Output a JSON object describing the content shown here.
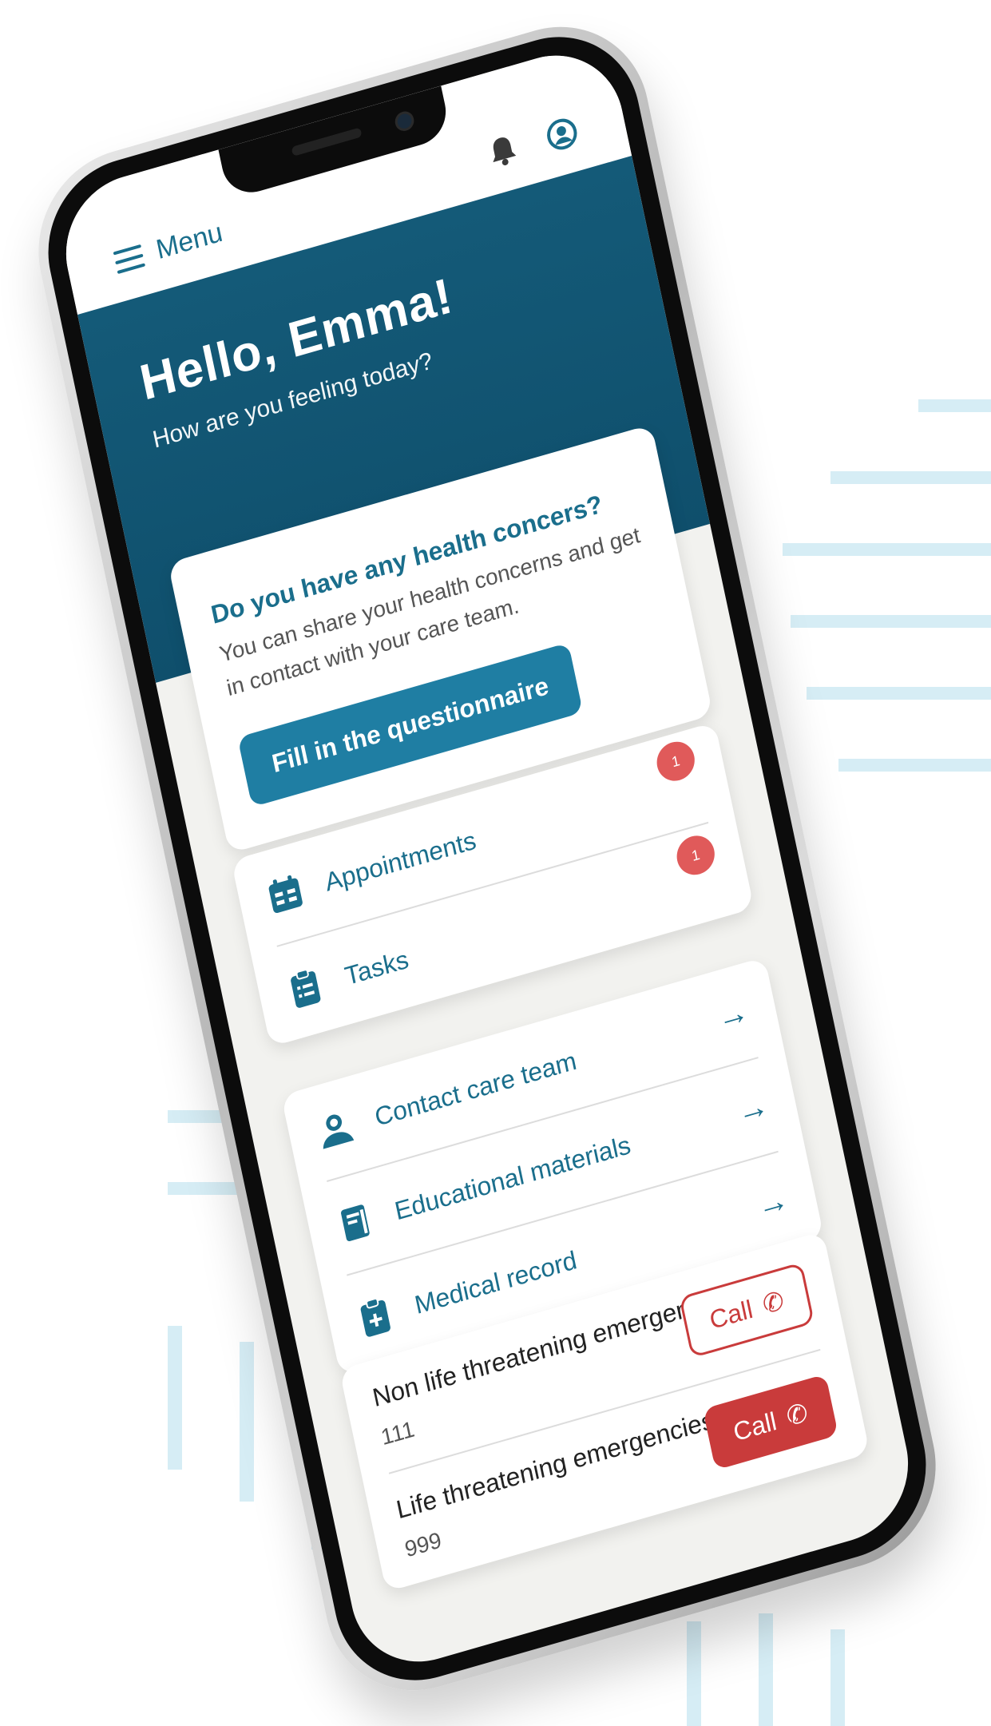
{
  "topbar": {
    "menu_label": "Menu"
  },
  "hero": {
    "greeting": "Hello, Emma!",
    "subtitle": "How are you feeling today?"
  },
  "concern_card": {
    "title": "Do you have any health concers?",
    "body": "You can share your health concerns and get in contact with your care team.",
    "button_label": "Fill in the questionnaire"
  },
  "list1": {
    "items": [
      {
        "label": "Appointments",
        "badge": "1",
        "icon": "calendar-icon"
      },
      {
        "label": "Tasks",
        "badge": "1",
        "icon": "clipboard-icon"
      }
    ]
  },
  "list2": {
    "items": [
      {
        "label": "Contact care team",
        "icon": "care-team-icon"
      },
      {
        "label": "Educational materials",
        "icon": "book-icon"
      },
      {
        "label": "Medical record",
        "icon": "medical-record-icon"
      }
    ]
  },
  "emergency": {
    "items": [
      {
        "title": "Non life threatening emergencies",
        "number": "111",
        "call_label": "Call"
      },
      {
        "title": "Life threatening emergencies",
        "number": "999",
        "call_label": "Call"
      }
    ]
  },
  "colors": {
    "primary": "#1a6e8c",
    "hero": "#145a78",
    "danger": "#c93b3b",
    "badge": "#e05a5a"
  }
}
